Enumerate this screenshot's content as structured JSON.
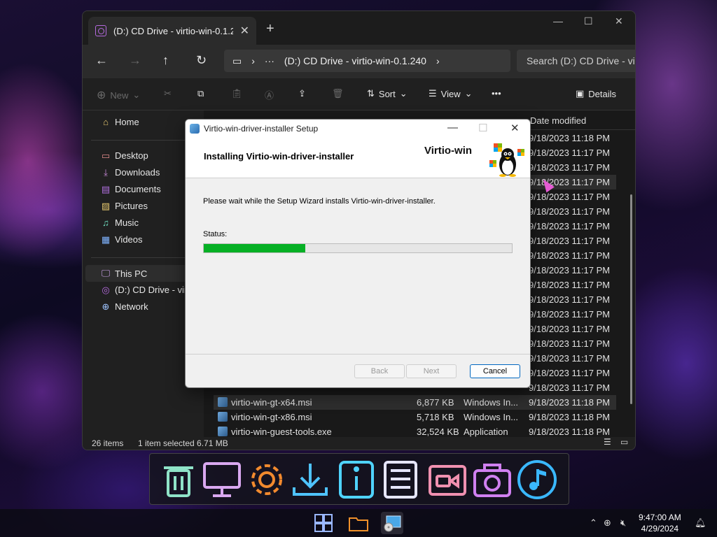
{
  "explorer": {
    "tab_title": "(D:) CD Drive - virtio-win-0.1.2",
    "address_path": "(D:) CD Drive - virtio-win-0.1.240",
    "search_placeholder": "Search (D:) CD Drive - virt",
    "toolbar": {
      "new_label": "New",
      "sort_label": "Sort",
      "view_label": "View",
      "more_label": "•••",
      "details_label": "Details"
    },
    "sidebar": {
      "home": "Home",
      "desktop": "Desktop",
      "downloads": "Downloads",
      "documents": "Documents",
      "pictures": "Pictures",
      "music": "Music",
      "videos": "Videos",
      "this_pc": "This PC",
      "cd_drive": "(D:) CD Drive - vir",
      "network": "Network"
    },
    "columns": {
      "date_modified": "Date modified"
    },
    "date_rows": [
      "9/18/2023 11:18 PM",
      "9/18/2023 11:17 PM",
      "9/18/2023 11:17 PM",
      "9/18/2023 11:17 PM",
      "9/18/2023 11:17 PM",
      "9/18/2023 11:17 PM",
      "9/18/2023 11:17 PM",
      "9/18/2023 11:17 PM",
      "9/18/2023 11:17 PM",
      "9/18/2023 11:17 PM",
      "9/18/2023 11:17 PM",
      "9/18/2023 11:17 PM",
      "9/18/2023 11:17 PM",
      "9/18/2023 11:17 PM",
      "9/18/2023 11:17 PM",
      "9/18/2023 11:17 PM",
      "9/18/2023 11:17 PM",
      "9/18/2023 11:17 PM"
    ],
    "files": [
      {
        "name": "virtio-win-gt-x64.msi",
        "size": "6,877 KB",
        "type": "Windows In...",
        "date": "9/18/2023 11:18 PM"
      },
      {
        "name": "virtio-win-gt-x86.msi",
        "size": "5,718 KB",
        "type": "Windows In...",
        "date": "9/18/2023 11:18 PM"
      },
      {
        "name": "virtio-win-guest-tools.exe",
        "size": "32,524 KB",
        "type": "Application",
        "date": "9/18/2023 11:18 PM"
      }
    ],
    "status": {
      "items_count": "26 items",
      "selection": "1 item selected  6.71 MB"
    }
  },
  "dialog": {
    "title": "Virtio-win-driver-installer Setup",
    "heading": "Installing Virtio-win-driver-installer",
    "brand": "Virtio-win",
    "message": "Please wait while the Setup Wizard installs Virtio-win-driver-installer.",
    "status_label": "Status:",
    "progress_fraction": 0.33,
    "buttons": {
      "back": "Back",
      "next": "Next",
      "cancel": "Cancel"
    }
  },
  "taskbar": {
    "time": "9:47:00 AM",
    "date": "4/29/2024"
  },
  "colors": {
    "progress_green": "#06b025",
    "accent_blue": "#0067c0"
  }
}
